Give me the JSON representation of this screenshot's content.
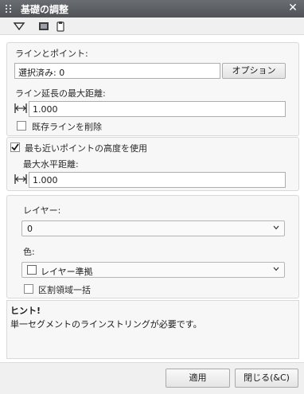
{
  "window": {
    "title": "基礎の調整"
  },
  "line_points": {
    "section_label": "ラインとポイント:",
    "selected_value": "選択済み: 0",
    "options_button": "オプション",
    "max_extend_label": "ライン延長の最大距離:",
    "max_extend_value": "1.000",
    "delete_existing_label": "既存ラインを削除",
    "delete_existing_checked": false
  },
  "elevation": {
    "use_nearest_label": "最も近いポイントの高度を使用",
    "use_nearest_checked": true,
    "max_horizontal_label": "最大水平距離:",
    "max_horizontal_value": "1.000"
  },
  "layer": {
    "layer_label": "レイヤー:",
    "layer_value": "0",
    "color_label": "色:",
    "color_value": "レイヤー準拠",
    "color_swatch": "#ffffff",
    "partition_label": "区割領域一括",
    "partition_checked": false
  },
  "hint": {
    "title": "ヒント!",
    "text": "単一セグメントのラインストリングが必要です。"
  },
  "footer": {
    "apply_label": "適用",
    "close_label": "閉じる(&C)"
  },
  "colors": {
    "titlebar": "#55585d",
    "accent_check": "#1a1a1a"
  }
}
